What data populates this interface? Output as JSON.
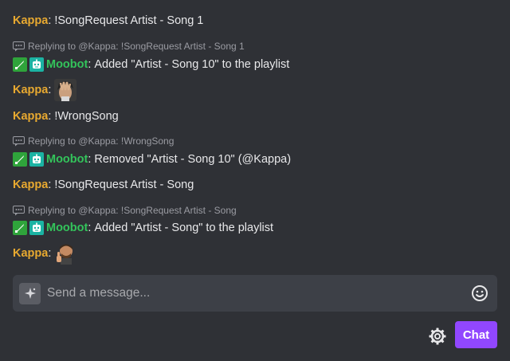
{
  "colors": {
    "kappa": "#e8a930",
    "moobot": "#33c45b",
    "mod_badge": "#2fa43b",
    "bot_badge": "#1bb3a3",
    "accent": "#9147ff"
  },
  "messages": [
    {
      "user": "Kappa",
      "text": "!SongRequest Artist - Song 1"
    },
    {
      "reply_to": "Replying to @Kappa: !SongRequest Artist - Song 1",
      "badges": [
        "moderator-badge",
        "bot-badge"
      ],
      "user": "Moobot",
      "text": "Added \"Artist - Song 10\" to the playlist"
    },
    {
      "user": "Kappa",
      "emote": "facepalm-emote"
    },
    {
      "user": "Kappa",
      "text": "!WrongSong"
    },
    {
      "reply_to": "Replying to @Kappa: !WrongSong",
      "badges": [
        "moderator-badge",
        "bot-badge"
      ],
      "user": "Moobot",
      "text": "Removed \"Artist - Song 10\" (@Kappa)"
    },
    {
      "user": "Kappa",
      "text": "!SongRequest Artist - Song"
    },
    {
      "reply_to": "Replying to @Kappa: !SongRequest Artist - Song",
      "badges": [
        "moderator-badge",
        "bot-badge"
      ],
      "user": "Moobot",
      "text": "Added \"Artist - Song\" to the playlist"
    },
    {
      "user": "Kappa",
      "emote": "thumbs-up-emote"
    }
  ],
  "input": {
    "placeholder": "Send a message...",
    "left_icon": "sparkle-icon",
    "right_icon": "emoji-smiley-icon"
  },
  "footer": {
    "settings_icon": "gear-icon",
    "chat_label": "Chat"
  }
}
